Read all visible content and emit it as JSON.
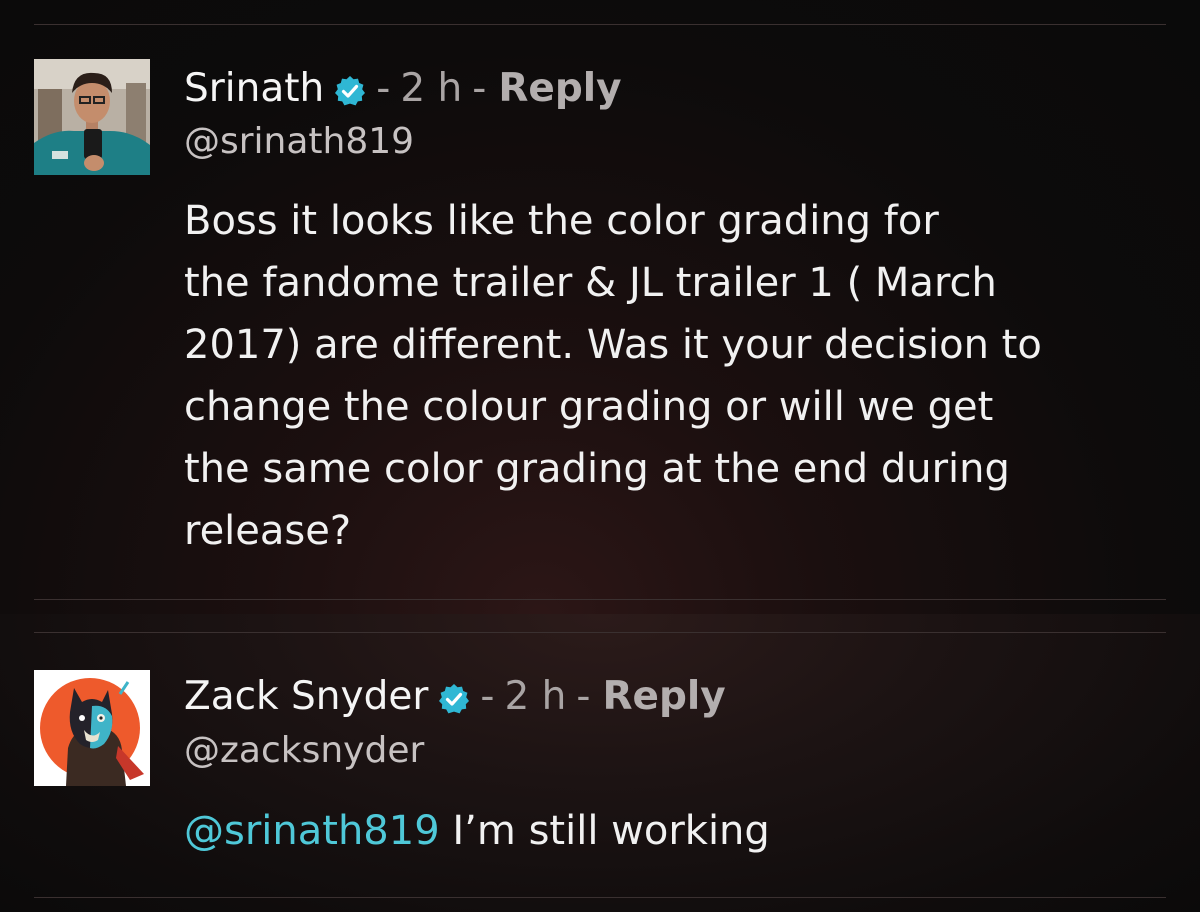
{
  "comments": [
    {
      "author": "Srinath",
      "verified": true,
      "separator": "-",
      "time": "2 h",
      "reply_label": "Reply",
      "handle": "@srinath819",
      "body_lines": [
        "Boss it looks like the color grading for",
        "the fandome trailer & JL trailer 1 ( March",
        "2017) are different. Was it your decision to",
        "change the colour grading or will we get",
        "the same color grading at the end during",
        "release?"
      ]
    },
    {
      "author": "Zack Snyder",
      "verified": true,
      "separator": "-",
      "time": "2 h",
      "reply_label": "Reply",
      "handle": "@zacksnyder",
      "mention": "@srinath819",
      "body": "I’m still working"
    }
  ],
  "colors": {
    "verified_badge": "#2fb7d4",
    "mention": "#4fc8d8"
  },
  "icons": {
    "verified": "verified-badge-icon"
  }
}
